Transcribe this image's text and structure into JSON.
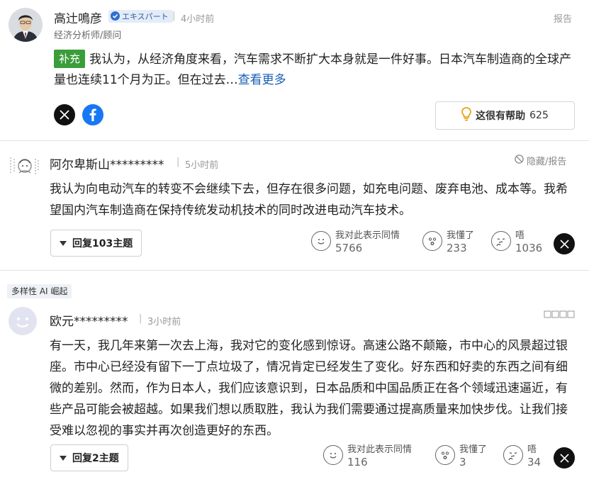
{
  "expert": {
    "name": "高辻鳴彦",
    "badge": "エキスパート",
    "time": "4小时前",
    "role": "经济分析师/顾问",
    "report": "报告",
    "tag": "补充",
    "text": "我认为，从经济角度来看，汽车需求不断扩大本身就是一件好事。日本汽车制造商的全球产量也连续11个月为正。但在过去…",
    "more": "查看更多",
    "helpful_label": "这很有帮助",
    "helpful_count": "625"
  },
  "comments": [
    {
      "name": "阿尔卑斯山*********",
      "time": "5小时前",
      "hide_report": "隐藏/报告",
      "text": "我认为向电动汽车的转变不会继续下去，但存在很多问题，如充电问题、废弃电池、成本等。我希望国内汽车制造商在保持传统发动机技术的同时改进电动汽车技术。",
      "reply": "回复103主题",
      "reactions": [
        {
          "label": "我对此表示同情",
          "count": "5766",
          "icon": "smile-face-icon"
        },
        {
          "label": "我懂了",
          "count": "233",
          "icon": "surprised-face-icon"
        },
        {
          "label": "唔",
          "count": "1036",
          "icon": "thinking-face-icon"
        }
      ]
    },
    {
      "tag": "多样性 AI 崛起",
      "name": "欧元*********",
      "time": "3小时前",
      "text": "有一天，我几年来第一次去上海，我对它的变化感到惊讶。高速公路不颠簸，市中心的风景超过银座。市中心已经没有留下一丁点垃圾了，情况肯定已经发生了变化。好东西和好卖的东西之间有细微的差别。然而，作为日本人，我们应该意识到，日本品质和中国品质正在各个领域迅速逼近，有些产品可能会被超越。如果我们想以质取胜，我认为我们需要通过提高质量来加快步伐。让我们接受难以忽视的事实并再次创造更好的东西。",
      "reply": "回复2主题",
      "reactions": [
        {
          "label": "我对此表示同情",
          "count": "116",
          "icon": "smile-face-icon"
        },
        {
          "label": "我懂了",
          "count": "3",
          "icon": "surprised-face-icon"
        },
        {
          "label": "唔",
          "count": "34",
          "icon": "thinking-face-icon"
        }
      ]
    }
  ]
}
